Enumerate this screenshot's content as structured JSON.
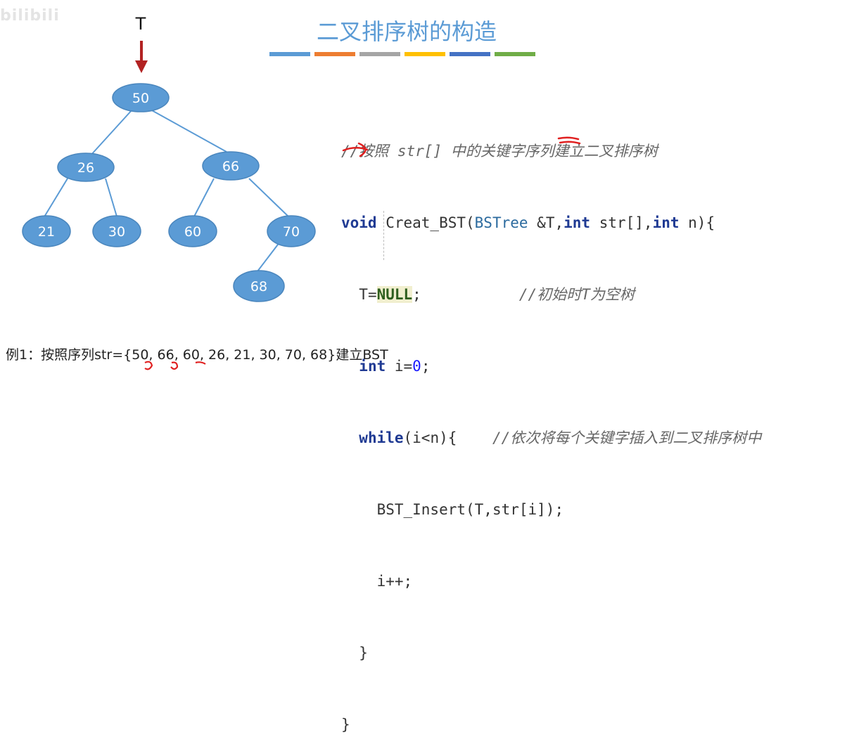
{
  "watermark": "bilibili",
  "title": "二叉排序树的构造",
  "title_bar_colors": [
    "#5b9bd5",
    "#ed7d31",
    "#a5a5a5",
    "#ffc000",
    "#4472c4",
    "#70ad47"
  ],
  "pointer_label": "T",
  "tree": {
    "node_fill": "#5b9bd5",
    "nodes": [
      {
        "id": "n50",
        "label": "50"
      },
      {
        "id": "n26",
        "label": "26"
      },
      {
        "id": "n66",
        "label": "66"
      },
      {
        "id": "n21",
        "label": "21"
      },
      {
        "id": "n30",
        "label": "30"
      },
      {
        "id": "n60",
        "label": "60"
      },
      {
        "id": "n70",
        "label": "70"
      },
      {
        "id": "n68",
        "label": "68"
      }
    ],
    "edges": [
      [
        "n50",
        "n26"
      ],
      [
        "n50",
        "n66"
      ],
      [
        "n26",
        "n21"
      ],
      [
        "n26",
        "n30"
      ],
      [
        "n66",
        "n60"
      ],
      [
        "n66",
        "n70"
      ],
      [
        "n70",
        "n68"
      ]
    ]
  },
  "code": {
    "comment_top": "//按照 str[] 中的关键字序列建立二叉排序树",
    "sig_void": "void",
    "sig_name": " Creat_BST(",
    "sig_type": "BSTree",
    "sig_space": " ",
    "sig_ref": "&T",
    "sig_comma1": ",",
    "sig_int1": "int",
    "sig_str": " str[],",
    "sig_int2": "int",
    "sig_n": " n){",
    "l3_a": "T=",
    "l3_null": "NULL",
    "l3_b": ";",
    "l3_comment": "//初始时T为空树",
    "l4_int": "int",
    "l4_a": " i=",
    "l4_zero": "0",
    "l4_b": ";",
    "l5_while": "while",
    "l5_a": "(i<n){",
    "l5_comment": "//依次将每个关键字插入到二叉排序树中",
    "l6": "BST_Insert(T,str[i]);",
    "l7": "i++;",
    "l8": "}",
    "l9": "}"
  },
  "example": "例1：按照序列str={50, 66, 60, 26, 21, 30, 70, 68}建立BST",
  "annotation_color": "#e02020",
  "arrow_color": "#b22222"
}
